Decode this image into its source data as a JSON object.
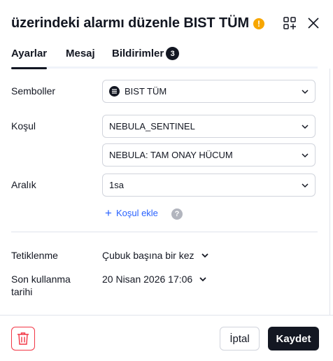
{
  "header": {
    "title": "üzerindeki alarmı düzenle BIST TÜM",
    "warning_glyph": "!"
  },
  "tabs": [
    {
      "label": "Ayarlar",
      "active": true
    },
    {
      "label": "Mesaj",
      "active": false
    },
    {
      "label": "Bildirimler",
      "active": false,
      "badge": "3"
    }
  ],
  "form": {
    "symbols": {
      "label": "Semboller",
      "value": "BIST TÜM"
    },
    "condition": {
      "label": "Koşul",
      "value": "NEBULA_SENTINEL",
      "sub_value": "NEBULA: TAM ONAY HÜCUM"
    },
    "interval": {
      "label": "Aralık",
      "value": "1sa"
    },
    "add_condition": "Koşul ekle",
    "help_glyph": "?",
    "trigger": {
      "label": "Tetiklenme",
      "value": "Çubuk başına bir kez"
    },
    "expiry": {
      "label_line1": "Son kullanma",
      "label_line2": "tarihi",
      "value": "20 Nisan 2026 17:06"
    }
  },
  "footer": {
    "cancel_label": "İptal",
    "save_label": "Kaydet"
  },
  "colors": {
    "accent_link": "#2962ff",
    "warning": "#f7a600",
    "danger": "#f23645",
    "primary_dark": "#131722",
    "border": "#d1d4dc"
  },
  "icons": [
    "warning-icon",
    "add-to-grid-icon",
    "close-icon",
    "symbol-list-icon",
    "chevron-down-icon",
    "plus-icon",
    "help-icon",
    "trash-icon"
  ]
}
